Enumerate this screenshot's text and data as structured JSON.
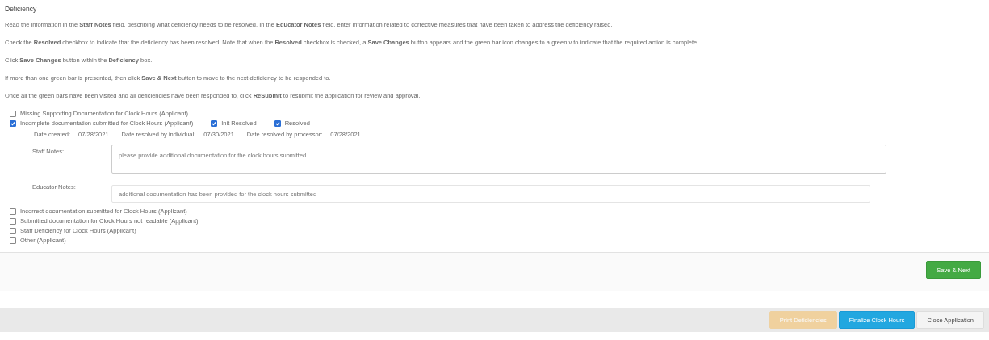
{
  "section_title": "Deficiency",
  "instructions": [
    "Read the information in the **Staff Notes** field, describing what deficiency needs to be resolved. In the **Educator Notes** field, enter information related to corrective measures that have been taken to address the deficiency raised.",
    "Check the **Resolved** checkbox to indicate that the deficiency has been resolved. Note that when the **Resolved** checkbox is checked, a **Save Changes** button appears and the green bar icon changes to a green v to indicate that the required action is complete.",
    "Click **Save Changes** button within the **Deficiency** box.",
    "If more than one green bar is presented, then click **Save & Next** button to move to the next deficiency to be responded to.",
    "Once all the green bars have been visited and all deficiencies have been responded to, click **ReSubmit** to resubmit the application for review and approval."
  ],
  "deficiencies": [
    {
      "kind": "plain",
      "label": "Missing Supporting Documentation for Clock Hours (Applicant)",
      "checked": false
    },
    {
      "kind": "detail",
      "label": "Incomplete documentation submitted for Clock Hours (Applicant)",
      "checked": true,
      "initial_resolved": {
        "label": "Init Resolved",
        "checked": true
      },
      "resolved": {
        "label": "Resolved",
        "checked": true
      },
      "dates": [
        {
          "label": "Date created:",
          "value": "07/28/2021"
        },
        {
          "label": "Date resolved by individual:",
          "value": "07/30/2021"
        },
        {
          "label": "Date resolved by processor:",
          "value": "07/28/2021"
        }
      ],
      "staff_notes": {
        "label": "Staff Notes:",
        "value": "please provide additional documentation for the clock hours submitted"
      },
      "educator_notes": {
        "label": "Educator Notes:",
        "value": "additional documentation has been provided for the clock hours submitted"
      }
    },
    {
      "kind": "plain",
      "label": "Incorrect documentation submitted for Clock Hours (Applicant)",
      "checked": false
    },
    {
      "kind": "plain",
      "label": "Submitted documentation for Clock Hours not readable (Applicant)",
      "checked": false
    },
    {
      "kind": "plain",
      "label": "Staff Deficiency for Clock Hours (Applicant)",
      "checked": false
    },
    {
      "kind": "plain",
      "label": "Other (Applicant)",
      "checked": false
    }
  ],
  "save_next_button": "Save & Next",
  "footer_buttons": [
    {
      "kind": "warning",
      "label": "Print Deficiencies",
      "disabled": true
    },
    {
      "kind": "info",
      "label": "Finalize Clock Hours",
      "disabled": false
    },
    {
      "kind": "default",
      "label": "Close Application",
      "disabled": false
    }
  ]
}
